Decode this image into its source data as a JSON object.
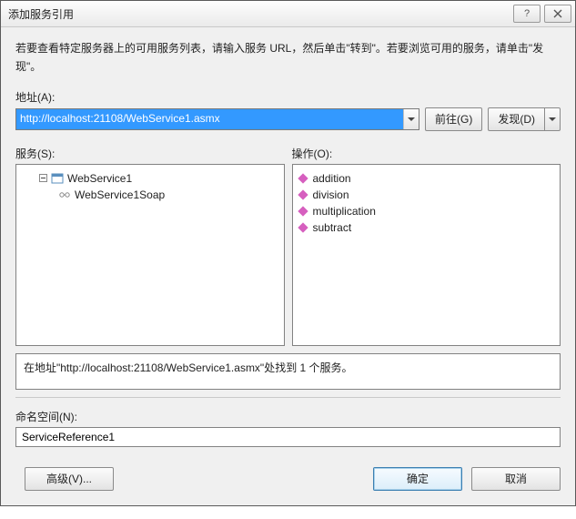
{
  "title": "添加服务引用",
  "instructions": "若要查看特定服务器上的可用服务列表，请输入服务 URL，然后单击\"转到\"。若要浏览可用的服务，请单击\"发现\"。",
  "address": {
    "label": "地址(A):",
    "value": "http://localhost:21108/WebService1.asmx",
    "go": "前往(G)",
    "discover": "发现(D)"
  },
  "services": {
    "label": "服务(S):",
    "root": "WebService1",
    "children": [
      "WebService1Soap"
    ]
  },
  "operations": {
    "label": "操作(O):",
    "items": [
      "addition",
      "division",
      "multiplication",
      "subtract"
    ]
  },
  "status": "在地址\"http://localhost:21108/WebService1.asmx\"处找到 1 个服务。",
  "namespace": {
    "label": "命名空间(N):",
    "value": "ServiceReference1"
  },
  "buttons": {
    "advanced": "高级(V)...",
    "ok": "确定",
    "cancel": "取消"
  }
}
